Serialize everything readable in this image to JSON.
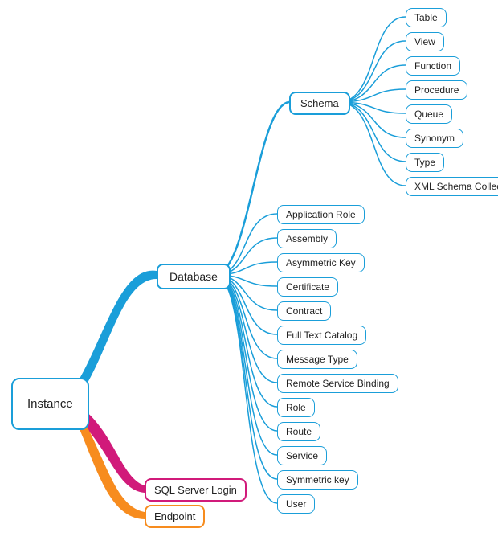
{
  "type": "mindmap",
  "colors": {
    "blue": "#1a9ed9",
    "magenta": "#d11a7a",
    "orange": "#f78c1e"
  },
  "root": {
    "label": "Instance",
    "children": [
      {
        "key": "database",
        "label": "Database",
        "color": "blue",
        "children": [
          {
            "key": "schema",
            "label": "Schema",
            "color": "blue",
            "children": [
              {
                "label": "Table"
              },
              {
                "label": "View"
              },
              {
                "label": "Function"
              },
              {
                "label": "Procedure"
              },
              {
                "label": "Queue"
              },
              {
                "label": "Synonym"
              },
              {
                "label": "Type"
              },
              {
                "label": "XML Schema Collection"
              }
            ]
          },
          {
            "label": "Application Role"
          },
          {
            "label": "Assembly"
          },
          {
            "label": "Asymmetric Key"
          },
          {
            "label": "Certificate"
          },
          {
            "label": "Contract"
          },
          {
            "label": "Full Text Catalog"
          },
          {
            "label": "Message Type"
          },
          {
            "label": "Remote Service Binding"
          },
          {
            "label": "Role"
          },
          {
            "label": "Route"
          },
          {
            "label": "Service"
          },
          {
            "label": "Symmetric key"
          },
          {
            "label": "User"
          }
        ]
      },
      {
        "key": "login",
        "label": "SQL Server Login",
        "color": "magenta"
      },
      {
        "key": "endpoint",
        "label": "Endpoint",
        "color": "orange"
      }
    ]
  }
}
